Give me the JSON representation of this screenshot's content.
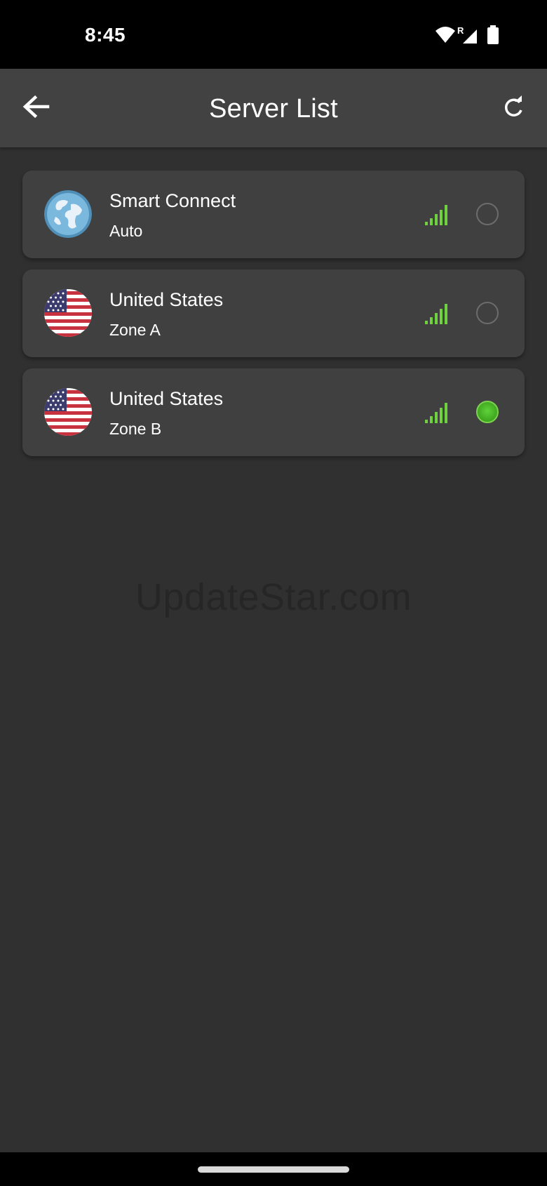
{
  "status_bar": {
    "time": "8:45",
    "roaming_indicator": "R",
    "icons": [
      "wifi-icon",
      "cell-signal-icon",
      "battery-icon"
    ]
  },
  "app_bar": {
    "title": "Server List",
    "back_icon": "arrow-left-icon",
    "refresh_icon": "refresh-icon"
  },
  "servers": [
    {
      "name": "Smart Connect",
      "zone": "Auto",
      "icon": "globe-icon",
      "signal_bars": 5,
      "selected": false
    },
    {
      "name": "United States",
      "zone": "Zone A",
      "icon": "us-flag-icon",
      "signal_bars": 5,
      "selected": false
    },
    {
      "name": "United States",
      "zone": "Zone B",
      "icon": "us-flag-icon",
      "signal_bars": 5,
      "selected": true
    }
  ],
  "watermark": "UpdateStar.com",
  "colors": {
    "background": "#303030",
    "app_bar": "#424242",
    "card": "#404040",
    "signal": "#6fd13f",
    "selected": "#4cbb28"
  }
}
